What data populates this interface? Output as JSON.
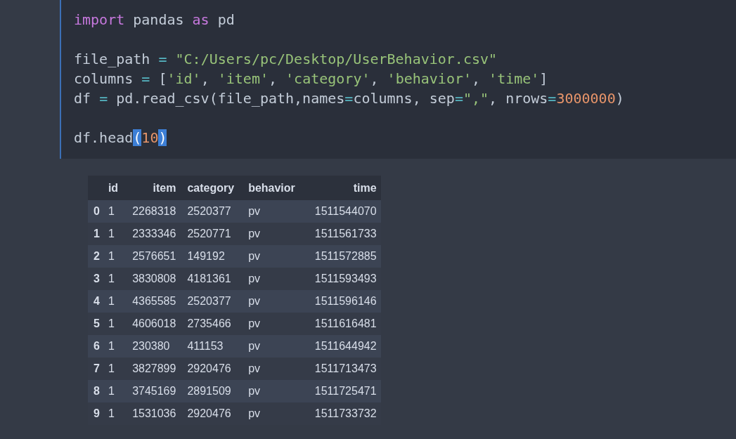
{
  "code_cell": {
    "blocks": [
      [
        {
          "tokens": [
            {
              "kind": "keyword",
              "text": "import"
            },
            {
              "kind": "plain",
              "text": " pandas "
            },
            {
              "kind": "keyword",
              "text": "as"
            },
            {
              "kind": "plain",
              "text": " pd"
            }
          ]
        }
      ],
      [
        {
          "tokens": [
            {
              "kind": "plain",
              "text": "file_path "
            },
            {
              "kind": "operator",
              "text": "="
            },
            {
              "kind": "string",
              "text": " \"C:/Users/pc/Desktop/UserBehavior.csv\""
            }
          ]
        },
        {
          "tokens": [
            {
              "kind": "plain",
              "text": "columns "
            },
            {
              "kind": "operator",
              "text": "="
            },
            {
              "kind": "plain",
              "text": " ["
            },
            {
              "kind": "string",
              "text": "'id'"
            },
            {
              "kind": "plain",
              "text": ", "
            },
            {
              "kind": "string",
              "text": "'item'"
            },
            {
              "kind": "plain",
              "text": ", "
            },
            {
              "kind": "string",
              "text": "'category'"
            },
            {
              "kind": "plain",
              "text": ", "
            },
            {
              "kind": "string",
              "text": "'behavior'"
            },
            {
              "kind": "plain",
              "text": ", "
            },
            {
              "kind": "string",
              "text": "'time'"
            },
            {
              "kind": "plain",
              "text": "]"
            }
          ]
        },
        {
          "tokens": [
            {
              "kind": "plain",
              "text": "df "
            },
            {
              "kind": "operator",
              "text": "="
            },
            {
              "kind": "plain",
              "text": " pd.read_csv(file_path,names"
            },
            {
              "kind": "operator",
              "text": "="
            },
            {
              "kind": "plain",
              "text": "columns, sep"
            },
            {
              "kind": "operator",
              "text": "="
            },
            {
              "kind": "string",
              "text": "\",\""
            },
            {
              "kind": "plain",
              "text": ", nrows"
            },
            {
              "kind": "operator",
              "text": "="
            },
            {
              "kind": "number",
              "text": "3000000"
            },
            {
              "kind": "plain",
              "text": ")"
            }
          ]
        }
      ],
      [
        {
          "tokens": [
            {
              "kind": "plain",
              "text": "df.head"
            },
            {
              "kind": "matched_bracket",
              "text": "("
            },
            {
              "kind": "number",
              "text": "10"
            },
            {
              "kind": "matched_bracket",
              "text": ")"
            }
          ]
        }
      ]
    ]
  },
  "output_table": {
    "columns": [
      "",
      "id",
      "item",
      "category",
      "behavior",
      "time"
    ],
    "rows": [
      [
        "0",
        "1",
        "2268318",
        "2520377",
        "pv",
        "1511544070"
      ],
      [
        "1",
        "1",
        "2333346",
        "2520771",
        "pv",
        "1511561733"
      ],
      [
        "2",
        "1",
        "2576651",
        "149192",
        "pv",
        "1511572885"
      ],
      [
        "3",
        "1",
        "3830808",
        "4181361",
        "pv",
        "1511593493"
      ],
      [
        "4",
        "1",
        "4365585",
        "2520377",
        "pv",
        "1511596146"
      ],
      [
        "5",
        "1",
        "4606018",
        "2735466",
        "pv",
        "1511616481"
      ],
      [
        "6",
        "1",
        "230380",
        "411153",
        "pv",
        "1511644942"
      ],
      [
        "7",
        "1",
        "3827899",
        "2920476",
        "pv",
        "1511713473"
      ],
      [
        "8",
        "1",
        "3745169",
        "2891509",
        "pv",
        "1511725471"
      ],
      [
        "9",
        "1",
        "1531036",
        "2920476",
        "pv",
        "1511733732"
      ]
    ]
  }
}
